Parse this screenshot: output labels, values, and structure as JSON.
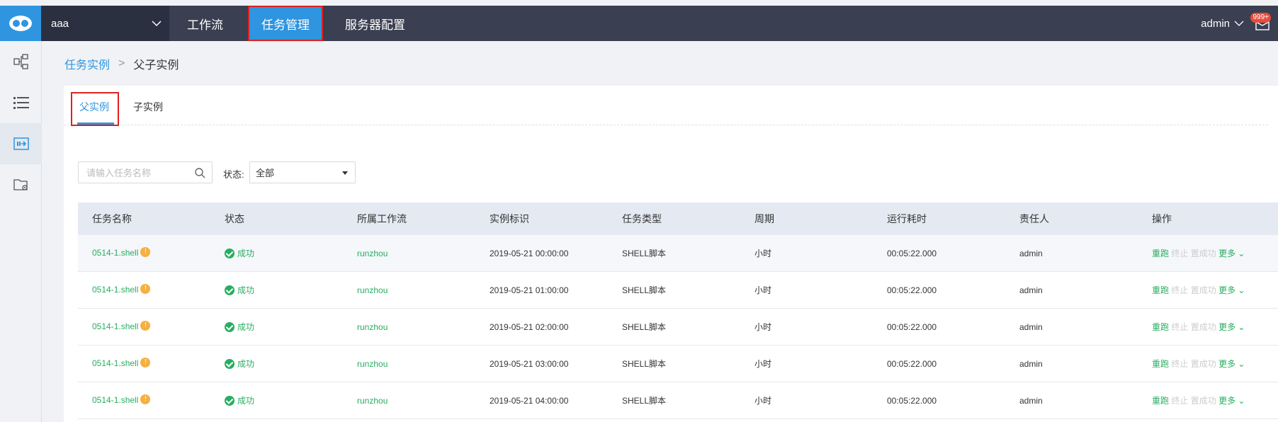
{
  "header": {
    "project": "aaa",
    "nav": [
      "工作流",
      "任务管理",
      "服务器配置"
    ],
    "user": "admin",
    "badge": "999+"
  },
  "breadcrumb": {
    "root": "任务实例",
    "current": "父子实例"
  },
  "tabs": [
    "父实例",
    "子实例"
  ],
  "filters": {
    "search_placeholder": "请输入任务名称",
    "status_label": "状态:",
    "status_value": "全部"
  },
  "table": {
    "headers": [
      "任务名称",
      "状态",
      "所属工作流",
      "实例标识",
      "任务类型",
      "周期",
      "运行耗时",
      "责任人",
      "操作"
    ],
    "ops": {
      "rerun": "重跑",
      "stop": "终止",
      "set_success": "置成功",
      "more": "更多"
    },
    "rows": [
      {
        "name": "0514-1.shell",
        "warn": "!",
        "status": "成功",
        "workflow": "runzhou",
        "instance": "2019-05-21 00:00:00",
        "type": "SHELL脚本",
        "period": "小时",
        "duration": "00:05:22.000",
        "owner": "admin"
      },
      {
        "name": "0514-1.shell",
        "warn": "!",
        "status": "成功",
        "workflow": "runzhou",
        "instance": "2019-05-21 01:00:00",
        "type": "SHELL脚本",
        "period": "小时",
        "duration": "00:05:22.000",
        "owner": "admin"
      },
      {
        "name": "0514-1.shell",
        "warn": "!",
        "status": "成功",
        "workflow": "runzhou",
        "instance": "2019-05-21 02:00:00",
        "type": "SHELL脚本",
        "period": "小时",
        "duration": "00:05:22.000",
        "owner": "admin"
      },
      {
        "name": "0514-1.shell",
        "warn": "!",
        "status": "成功",
        "workflow": "runzhou",
        "instance": "2019-05-21 03:00:00",
        "type": "SHELL脚本",
        "period": "小时",
        "duration": "00:05:22.000",
        "owner": "admin"
      },
      {
        "name": "0514-1.shell",
        "warn": "!",
        "status": "成功",
        "workflow": "runzhou",
        "instance": "2019-05-21 04:00:00",
        "type": "SHELL脚本",
        "period": "小时",
        "duration": "00:05:22.000",
        "owner": "admin"
      }
    ]
  },
  "sidebar_icons": [
    "workflow-structure-icon",
    "list-icon",
    "task-instance-icon",
    "folder-settings-icon"
  ],
  "colors": {
    "primary": "#2f95e0",
    "topbar": "#3a3f51",
    "success": "#27ae60",
    "highlight": "#e02020"
  }
}
